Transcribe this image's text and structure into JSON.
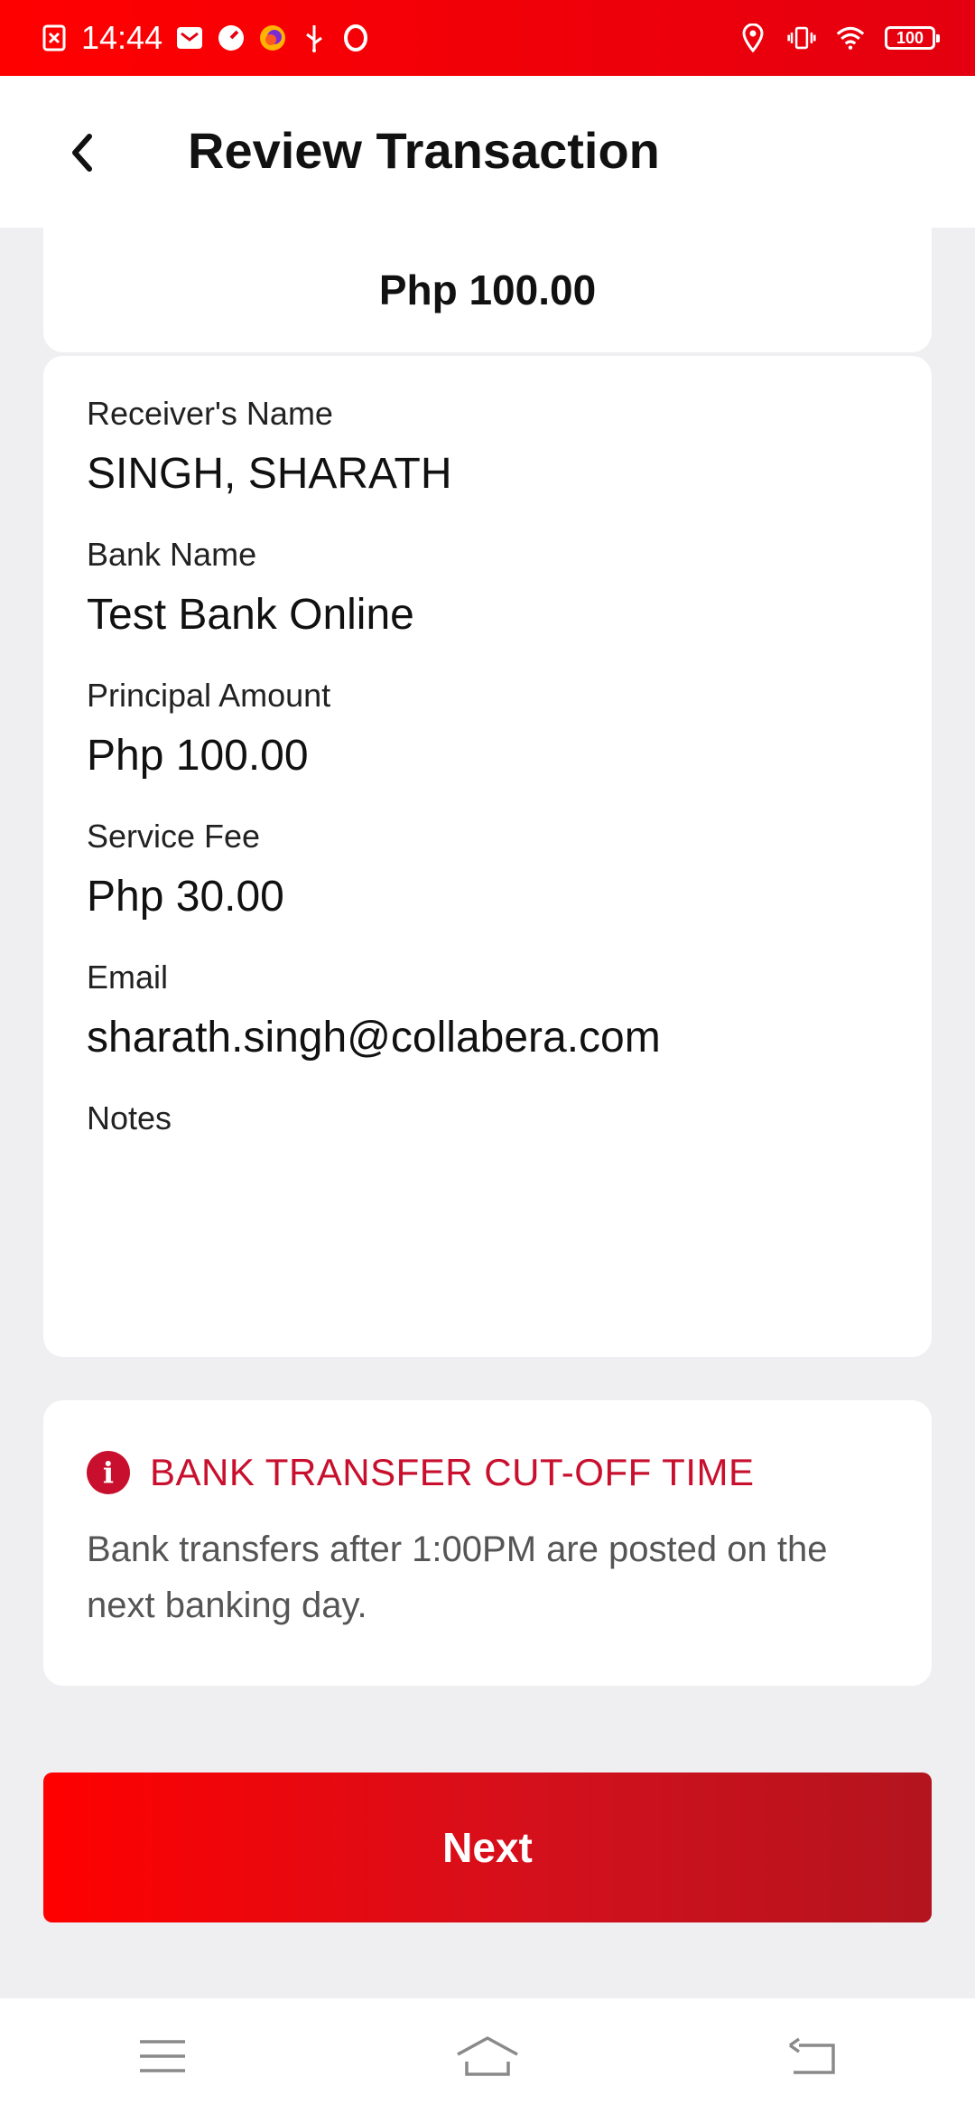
{
  "status_bar": {
    "time": "14:44",
    "battery": "100",
    "left_icons": [
      "screenshot-icon",
      "mail-icon",
      "speedometer-icon",
      "firefox-icon",
      "usb-icon",
      "opera-icon"
    ],
    "right_icons": [
      "location-icon",
      "vibrate-icon",
      "wifi-icon",
      "battery-icon"
    ]
  },
  "header": {
    "title": "Review Transaction",
    "back_icon": "back-arrow-icon"
  },
  "summary": {
    "amount": "Php 100.00"
  },
  "details": {
    "fields": [
      {
        "label": "Receiver's Name",
        "value": "SINGH, SHARATH"
      },
      {
        "label": "Bank Name",
        "value": "Test Bank Online"
      },
      {
        "label": "Principal Amount",
        "value": "Php 100.00"
      },
      {
        "label": "Service Fee",
        "value": "Php 30.00"
      },
      {
        "label": "Email",
        "value": "sharath.singh@collabera.com"
      },
      {
        "label": "Notes",
        "value": ""
      }
    ]
  },
  "notice": {
    "icon": "info-icon",
    "title": "BANK TRANSFER CUT-OFF TIME",
    "body": "Bank transfers after 1:00PM are posted on the next banking day."
  },
  "actions": {
    "next_label": "Next"
  },
  "nav_bar": {
    "items": [
      "menu-icon",
      "home-icon",
      "back-icon"
    ]
  },
  "colors": {
    "brand_red": "#e40010",
    "accent_red": "#c8102e",
    "background": "#efeff1"
  }
}
